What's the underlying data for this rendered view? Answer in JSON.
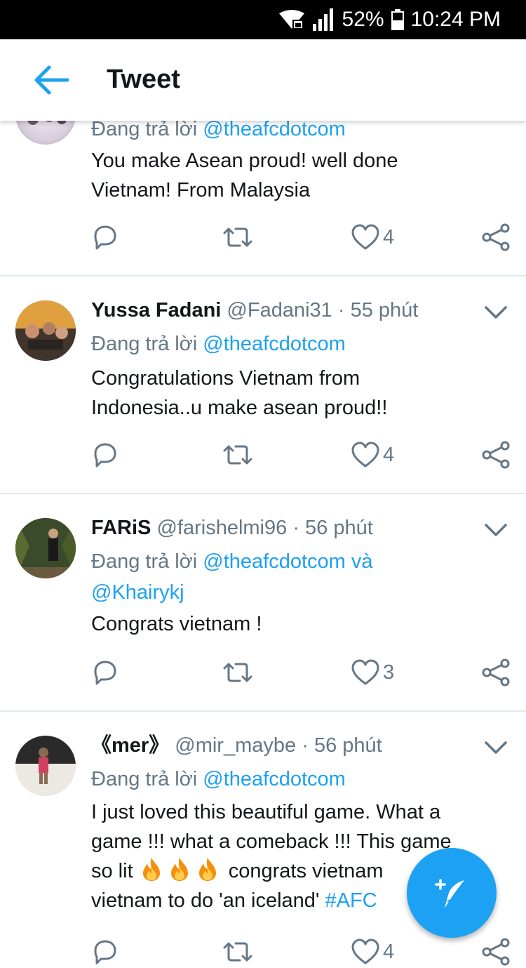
{
  "status_bar": {
    "battery": "52%",
    "time": "10:24 PM"
  },
  "app_bar": {
    "title": "Tweet"
  },
  "tweets": [
    {
      "name": "",
      "handle": "",
      "time": "",
      "reply_prefix": "Đang trả lời",
      "reply_to": "@theafcdotcom",
      "reply_extra": "",
      "reply_to2": "",
      "body_lines": [
        "You make Asean proud! well done",
        "Vietnam! From Malaysia"
      ],
      "likes": "4"
    },
    {
      "name": "Yussa Fadani",
      "handle": "@Fadani31",
      "time": "55 phút",
      "reply_prefix": "Đang trả lời",
      "reply_to": "@theafcdotcom",
      "body_lines": [
        "Congratulations Vietnam from",
        "Indonesia..u make asean proud!!"
      ],
      "likes": "4"
    },
    {
      "name": "FARiS",
      "handle": "@farishelmi96",
      "time": "56 phút",
      "reply_prefix": "Đang trả lời",
      "reply_to": "@theafcdotcom",
      "reply_extra": "và",
      "reply_to2": "@Khairykj",
      "body_lines": [
        "Congrats vietnam !"
      ],
      "likes": "3"
    },
    {
      "name": "《mer》",
      "handle": "@mir_maybe",
      "time": "56 phút",
      "reply_prefix": "Đang trả lời",
      "reply_to": "@theafcdotcom",
      "body_lines": [
        "I just loved this beautiful game. What a",
        "game !!! what a comeback !!! This game"
      ],
      "body_line3_prefix": "so lit",
      "body_line3_suffix": "congrats vietnam",
      "body_line4_prefix": "vietnam to do 'an iceland'",
      "body_line4_tag": "#AFC",
      "likes": "4"
    }
  ],
  "separator": "·",
  "icons": {
    "back": "arrow-left-icon",
    "reply": "reply-icon",
    "retweet": "retweet-icon",
    "like": "heart-icon",
    "share": "share-icon",
    "more": "chevron-down-icon",
    "compose": "compose-tweet-icon",
    "fire": "fire-emoji"
  },
  "colors": {
    "accent": "#1da1f2",
    "muted": "#657786",
    "text": "#14171a",
    "divider": "#e1e8ed"
  }
}
